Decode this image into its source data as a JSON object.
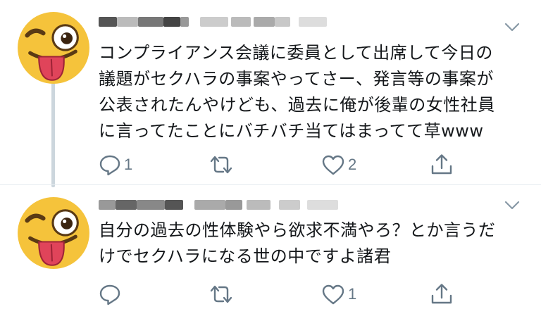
{
  "colors": {
    "icon": "#657786",
    "text": "#14171a",
    "thread_line": "#ccd6dd",
    "emoji_face": "#f5c33b",
    "emoji_tongue": "#e0445a"
  },
  "tweets": [
    {
      "avatar_icon": "winking-face-with-tongue-emoji",
      "menu_icon": "chevron-down-icon",
      "text": "コンプライアンス会議に委員として出席して今日の\n議題がセクハラの事案やってさー、発言等の事案が\n公表されたんやけども、過去に俺が後輩の女性社員\nに言ってたことにバチバチ当てはまってて草www",
      "reply_count": "1",
      "retweet_count": "",
      "like_count": "2"
    },
    {
      "avatar_icon": "winking-face-with-tongue-emoji",
      "menu_icon": "chevron-down-icon",
      "text": "自分の過去の性体験やら欲求不満やろ？とか言うだ\nけでセクハラになる世の中ですよ諸君",
      "reply_count": "",
      "retweet_count": "",
      "like_count": "1"
    }
  ]
}
